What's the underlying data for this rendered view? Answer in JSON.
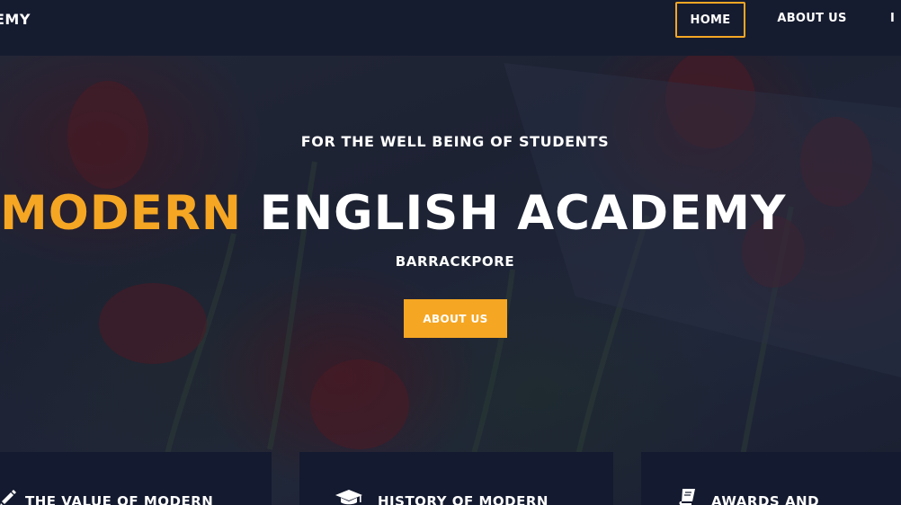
{
  "header": {
    "brand_text": "EMY",
    "nav": {
      "home": "HOME",
      "about": "ABOUT US",
      "next": "I"
    },
    "active_item": "HOME"
  },
  "hero": {
    "subtitle": "FOR THE WELL BEING OF STUDENTS",
    "title_accent": "MODERN",
    "title_rest": "ENGLISH ACADEMY",
    "location": "BARRACKPORE",
    "button_label": "ABOUT US"
  },
  "cards": [
    {
      "icon": "pencil-icon",
      "title": "THE VALUE OF MODERN"
    },
    {
      "icon": "graduation-cap-icon",
      "title": "HISTORY OF MODERN"
    },
    {
      "icon": "book-icon",
      "title": "AWARDS AND"
    }
  ],
  "colors": {
    "accent": "#f5a623",
    "navbar": "#161c30",
    "card": "#141a2f",
    "text": "#ffffff"
  }
}
